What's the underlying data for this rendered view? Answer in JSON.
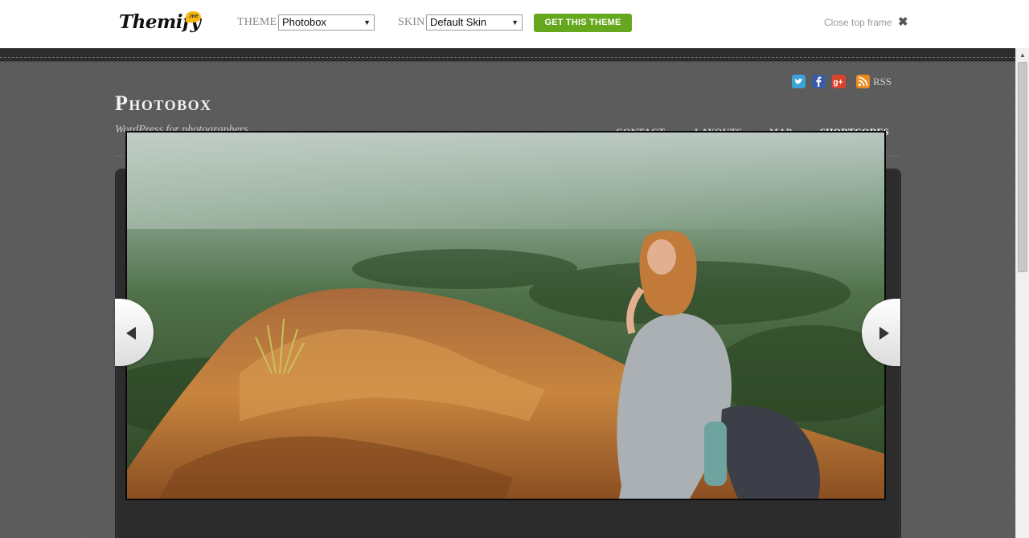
{
  "topbar": {
    "logo_text": "Themify",
    "logo_badge": ".me",
    "theme_label": "THEME",
    "theme_value": "Photobox",
    "skin_label": "SKIN",
    "skin_value": "Default Skin",
    "cta_label": "GET THIS THEME",
    "close_label": "Close top frame",
    "close_glyph": "✖",
    "cta_color": "#65a81e"
  },
  "site": {
    "title": "Photobox",
    "tagline": "WordPress for photographers",
    "rss_label": "RSS",
    "social_icons": [
      "twitter-icon",
      "facebook-icon",
      "google-plus-icon",
      "rss-icon"
    ],
    "nav": [
      {
        "label": "CONTACT"
      },
      {
        "label": "LAYOUTS"
      },
      {
        "label": "MAP"
      },
      {
        "label": "SHORTCODES",
        "active": true
      }
    ],
    "slider": {
      "image_subject": "woman sitting on a rocky cliff overlooking a forested valley",
      "prev_icon": "triangle-left-icon",
      "next_icon": "triangle-right-icon"
    }
  },
  "scrollbar": {
    "up_glyph": "▲"
  }
}
